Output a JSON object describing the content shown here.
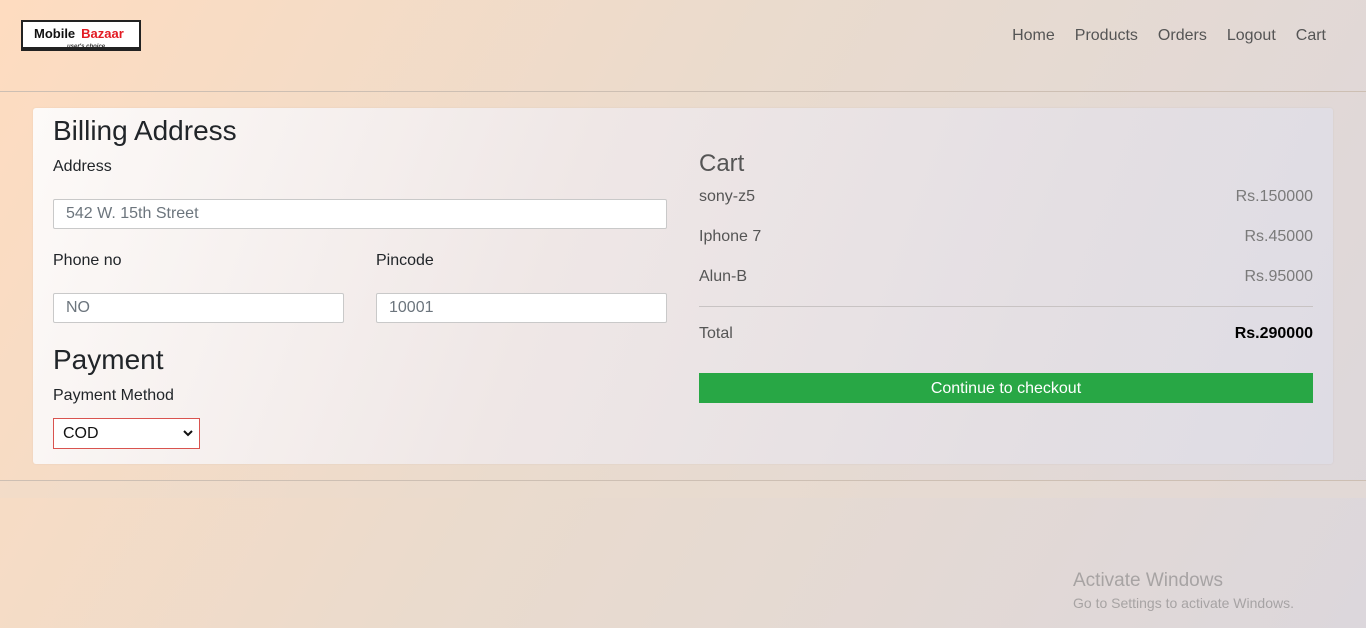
{
  "brand": {
    "name_part1": "Mobile",
    "name_part2": "Bazaar",
    "tagline": "user's choice"
  },
  "nav": {
    "items": [
      "Home",
      "Products",
      "Orders",
      "Logout",
      "Cart"
    ]
  },
  "billing": {
    "heading": "Billing Address",
    "address_label": "Address",
    "address_placeholder": "542 W. 15th Street",
    "phone_label": "Phone no",
    "phone_placeholder": "NO",
    "pincode_label": "Pincode",
    "pincode_placeholder": "10001"
  },
  "payment": {
    "heading": "Payment",
    "method_label": "Payment Method",
    "method_selected": "COD"
  },
  "cart": {
    "title": "Cart",
    "items": [
      {
        "name": "sony-z5",
        "price": "Rs.150000"
      },
      {
        "name": "Iphone 7",
        "price": "Rs.45000"
      },
      {
        "name": "Alun-B",
        "price": "Rs.95000"
      }
    ],
    "total_label": "Total",
    "total_value": "Rs.290000",
    "checkout_label": "Continue to checkout"
  },
  "watermark": {
    "line1": "Activate Windows",
    "line2": "Go to Settings to activate Windows."
  },
  "colors": {
    "checkout_button": "#28a745",
    "select_border": "#d9534f",
    "brand_accent": "#e31b23"
  }
}
